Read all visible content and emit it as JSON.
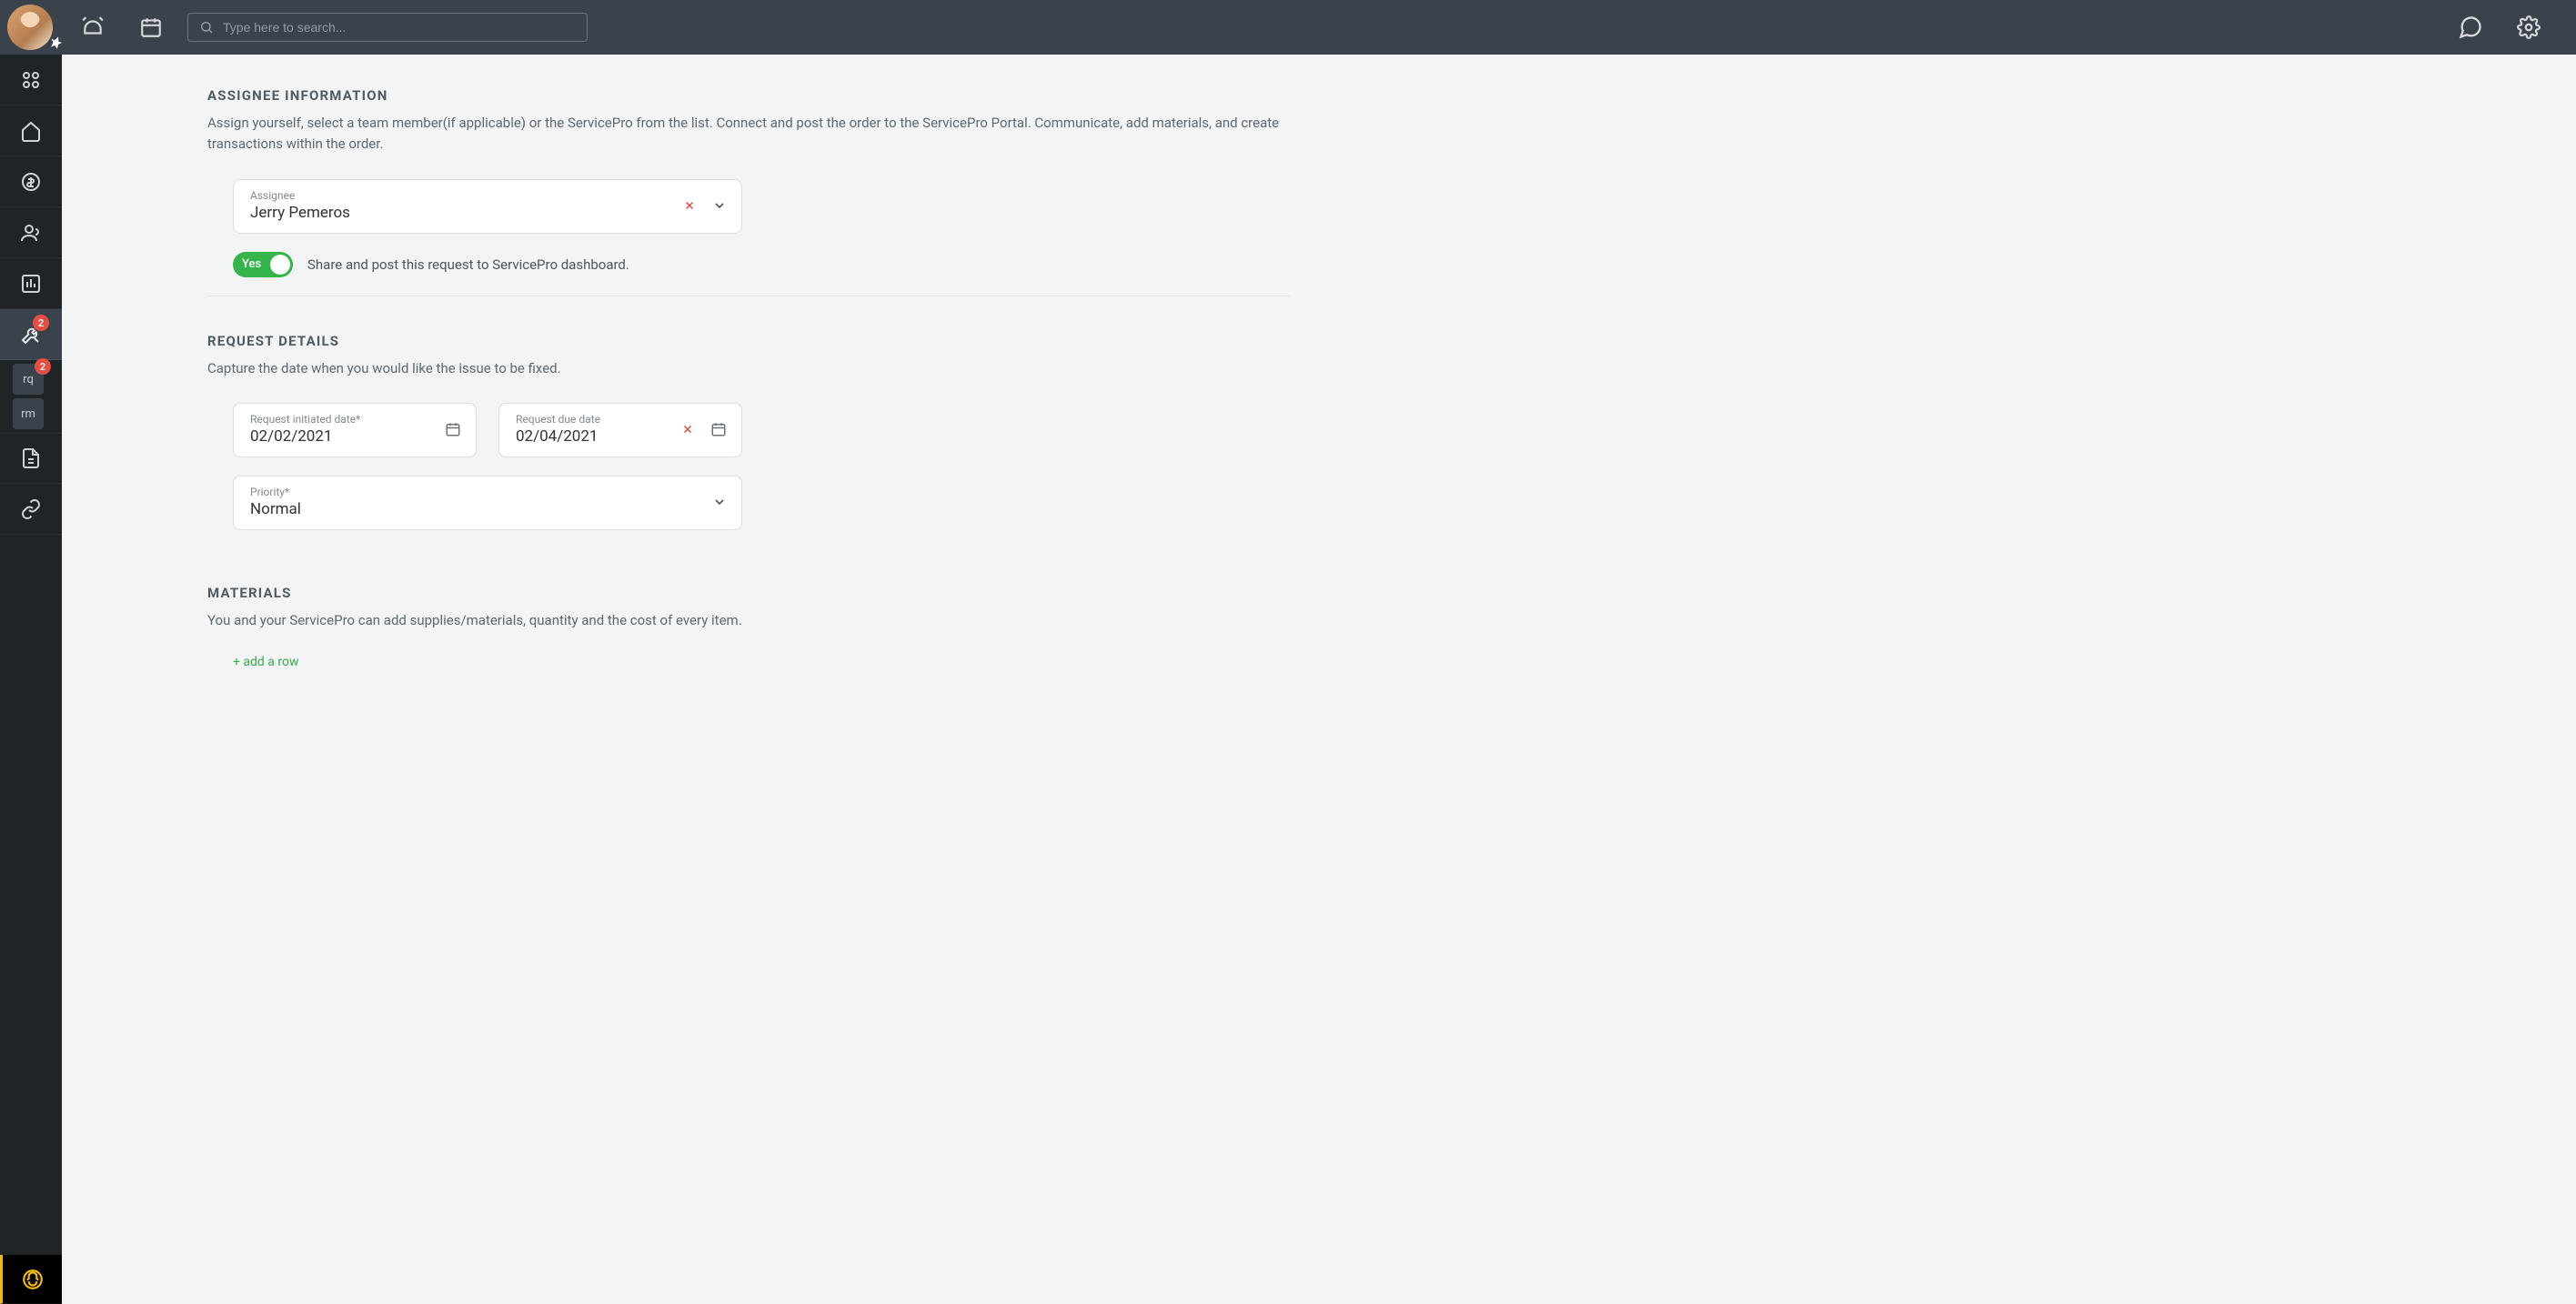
{
  "topbar": {
    "search_placeholder": "Type here to search..."
  },
  "sidebar": {
    "tools_badge": "2",
    "sub_rq_label": "rq",
    "sub_rq_badge": "2",
    "sub_rm_label": "rm"
  },
  "sections": {
    "assignee": {
      "title": "ASSIGNEE INFORMATION",
      "description": "Assign yourself, select a team member(if applicable) or the ServicePro from the list. Connect and post the order to the ServicePro Portal. Communicate, add materials, and create transactions within the order.",
      "field_label": "Assignee",
      "assignee_value": "Jerry Pemeros",
      "toggle_label": "Yes",
      "toggle_description": "Share and post this request to ServicePro dashboard."
    },
    "request": {
      "title": "REQUEST DETAILS",
      "description": "Capture the date when you would like the issue to be fixed.",
      "initiated_label": "Request initiated date*",
      "initiated_value": "02/02/2021",
      "due_label": "Request due date",
      "due_value": "02/04/2021",
      "priority_label": "Priority*",
      "priority_value": "Normal"
    },
    "materials": {
      "title": "MATERIALS",
      "description": "You and your ServicePro can add supplies/materials, quantity and the cost of every item.",
      "add_row": "+ add a row"
    }
  }
}
